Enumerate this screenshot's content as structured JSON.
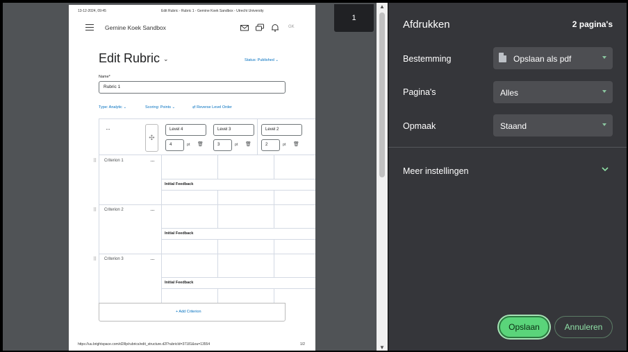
{
  "preview": {
    "page_badge": "1",
    "header_date": "13-12-2024, 09:45",
    "header_title": "Edit Rubric - Rubric 1 - Gernine Koek Sandbox - Utrecht University",
    "footer_url": "https://uu.brightspace.com/d2l/lp/rubrics/edit_structure.d2l?rubricId=37181&ou=13554",
    "footer_page": "1/2",
    "org_name": "Gernine Koek Sandbox",
    "user_initials": "GK",
    "page_title": "Edit Rubric",
    "status": "Status: Published",
    "name_label": "Name*",
    "name_value": "Rubric 1",
    "type_option": "Type: Analytic",
    "scoring_option": "Scoring: Points",
    "reverse_option": "Reverse Level Order",
    "levels": [
      {
        "name": "Level 4",
        "points": "4"
      },
      {
        "name": "Level 3",
        "points": "3"
      },
      {
        "name": "Level 2",
        "points": "2"
      }
    ],
    "pt_unit": "pt",
    "criteria": [
      "Criterion 1",
      "Criterion 2",
      "Criterion 3"
    ],
    "initial_feedback": "Initial Feedback",
    "add_criterion": "+ Add Criterion"
  },
  "print_panel": {
    "title": "Afdrukken",
    "page_count": "2 pagina's",
    "destination_label": "Bestemming",
    "destination_value": "Opslaan als pdf",
    "pages_label": "Pagina's",
    "pages_value": "Alles",
    "layout_label": "Opmaak",
    "layout_value": "Staand",
    "more_settings": "Meer instellingen",
    "save_button": "Opslaan",
    "cancel_button": "Annuleren"
  },
  "colors": {
    "panel_bg": "#35363a",
    "accent_green": "#5ad47a",
    "link_blue": "#006fbf"
  }
}
